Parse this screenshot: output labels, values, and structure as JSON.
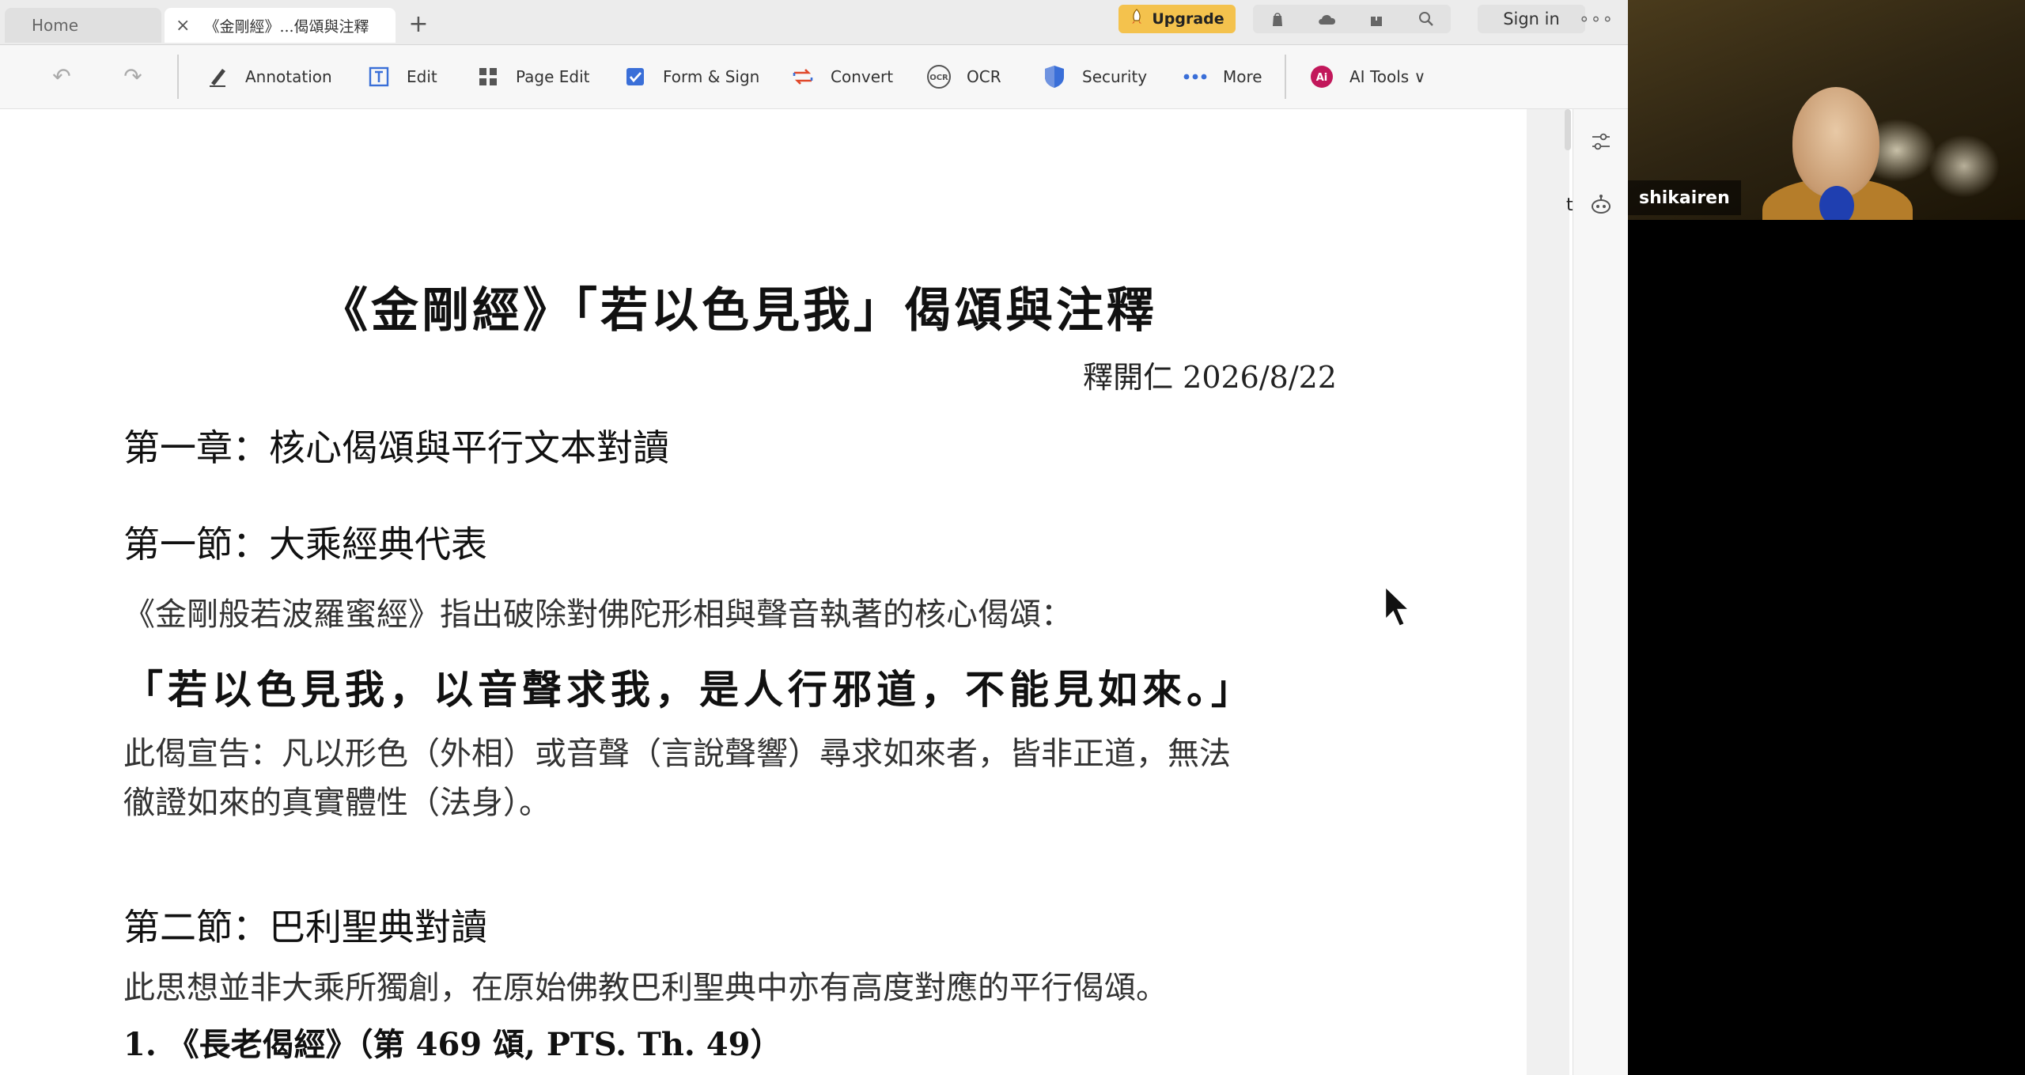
{
  "tabs": {
    "home_label": "Home",
    "doc_close": "×",
    "doc_title": "《金剛經》...偈頌與注釋",
    "new_tab": "+"
  },
  "topbar": {
    "upgrade_label": "Upgrade",
    "sign_in_label": "Sign in",
    "more": "∘∘∘",
    "icons": [
      "shop-bag-icon",
      "cloud-icon",
      "share-icon",
      "search-icon"
    ]
  },
  "toolbar": {
    "undo": "↶",
    "redo": "↷",
    "items": [
      {
        "name": "annotation",
        "label": "Annotation"
      },
      {
        "name": "edit",
        "label": "Edit"
      },
      {
        "name": "page-edit",
        "label": "Page Edit"
      },
      {
        "name": "form-sign",
        "label": "Form & Sign"
      },
      {
        "name": "convert",
        "label": "Convert"
      },
      {
        "name": "ocr",
        "label": "OCR"
      },
      {
        "name": "security",
        "label": "Security"
      },
      {
        "name": "more",
        "label": "More"
      },
      {
        "name": "ai-tools",
        "label": "AI Tools ∨"
      }
    ],
    "ocr_badge": "OCR",
    "ai_badge": "Ai"
  },
  "document": {
    "title": "《金剛經》「若以色見我」偈頌與注釋",
    "author": "釋開仁 2026/8/22",
    "chapter1": "第一章：核心偈頌與平行文本對讀",
    "section1": "第一節：大乘經典代表",
    "section1_intro": "《金剛般若波羅蜜經》指出破除對佛陀形相與聲音執著的核心偈頌：",
    "verse": "「若以色見我，以音聲求我，是人行邪道，不能見如來。」",
    "verse_explain_line1": "此偈宣告：凡以形色（外相）或音聲（言說聲響）尋求如來者，皆非正道，無法",
    "verse_explain_line2": "徹證如來的真實體性（法身）。",
    "section2": "第二節：巴利聖典對讀",
    "section2_intro": "此思想並非大乘所獨創，在原始佛教巴利聖典中亦有高度對應的平行偈頌。",
    "list1": "1.  《長老偈經》（第 469 頌, PTS. Th. 49）"
  },
  "side": {
    "clipped_label": "t"
  },
  "video": {
    "participant_name": "shikairen"
  },
  "colors": {
    "upgrade_bg": "#f4c24d",
    "accent_blue": "#3a6fd8",
    "ai_badge": "#c2185b"
  }
}
